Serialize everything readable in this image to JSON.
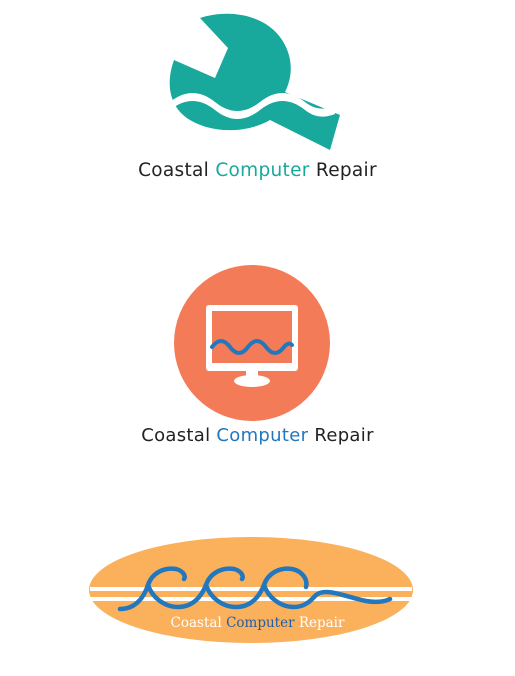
{
  "logos": [
    {
      "caption": {
        "part1": "Coastal ",
        "part2": "Computer",
        "part3": " Repair"
      },
      "icon": "wrench-wave-icon",
      "colors": {
        "primary": "#19a89c",
        "text": "#222222"
      }
    },
    {
      "caption": {
        "part1": "Coastal ",
        "part2": "Computer",
        "part3": " Repair"
      },
      "icon": "monitor-wave-icon",
      "colors": {
        "circle": "#f47b57",
        "wave": "#2377bd",
        "text": "#222222"
      }
    },
    {
      "monogram": "ccc",
      "caption": {
        "part1": "Coastal ",
        "part2": "Computer",
        "part3": " Repair"
      },
      "icon": "surfboard-icon",
      "colors": {
        "board": "#fbb05c",
        "wave": "#2377bd",
        "text": "#ffffff"
      }
    }
  ]
}
